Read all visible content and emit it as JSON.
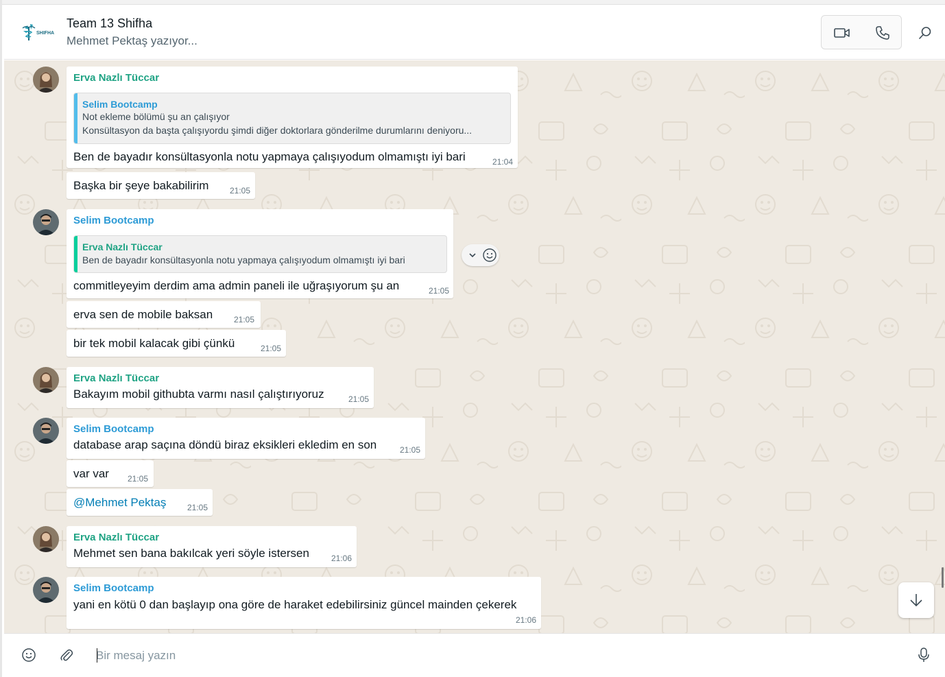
{
  "header": {
    "logo_text": "SHIFHA",
    "title": "Team 13 Shifha",
    "subtitle": "Mehmet Pektaş yazıyor...",
    "icons": {
      "video": "video-camera-icon",
      "call": "phone-icon",
      "search": "search-icon"
    }
  },
  "messages": [
    {
      "sender": "Erva Nazlı Tüccar",
      "quote_name": "Selim Bootcamp",
      "quote_line1": "Not ekleme bölümü şu an çalışıyor",
      "quote_line2": "Konsültasyon da başta çalışıyordu şimdi diğer doktorlara gönderilme durumlarını deniyoru...",
      "text": "Ben de bayadır konsültasyonla notu yapmaya çalışıyodum olmamıştı iyi bari",
      "time": "21:04"
    },
    {
      "text": "Başka bir şeye bakabilirim",
      "time": "21:05"
    },
    {
      "sender": "Selim Bootcamp",
      "quote_name": "Erva Nazlı Tüccar",
      "quote_line1": "Ben de bayadır konsültasyonla notu yapmaya çalışıyodum olmamıştı iyi bari",
      "text": "commitleyeyim derdim ama admin paneli ile uğraşıyorum şu an",
      "time": "21:05"
    },
    {
      "text": "erva sen de mobile baksan",
      "time": "21:05"
    },
    {
      "text": "bir tek mobil kalacak gibi çünkü",
      "time": "21:05"
    },
    {
      "sender": "Erva Nazlı Tüccar",
      "text": "Bakayım mobil githubta varmı nasıl çalıştırıyoruz",
      "time": "21:05"
    },
    {
      "sender": "Selim Bootcamp",
      "text": "database arap saçına döndü biraz eksikleri ekledim en son",
      "time": "21:05"
    },
    {
      "text": "var var",
      "time": "21:05"
    },
    {
      "text": "@Mehmet Pektaş",
      "time": "21:05"
    },
    {
      "sender": "Erva Nazlı Tüccar",
      "text": "Mehmet sen bana bakılcak yeri söyle istersen",
      "time": "21:06"
    },
    {
      "sender": "Selim Bootcamp",
      "text": "yani en kötü 0 dan başlayıp ona göre de haraket edebilirsiniz güncel mainden çekerek",
      "time": "21:06"
    }
  ],
  "composer": {
    "placeholder": "Bir mesaj yazın",
    "icons": {
      "emoji": "emoji-icon",
      "attach": "paperclip-icon",
      "mic": "microphone-icon"
    }
  },
  "colors": {
    "erva_name": "#1fa384",
    "selim_name": "#2d9bd6",
    "chat_bg": "#efeae2",
    "mention": "#027eb5"
  }
}
